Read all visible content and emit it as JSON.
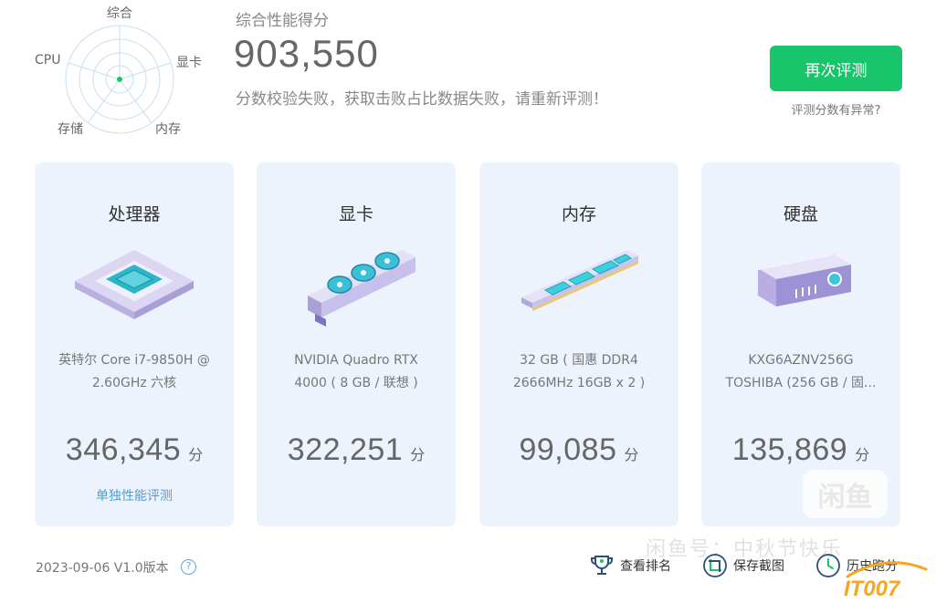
{
  "radar": {
    "labels": {
      "top": "综合",
      "left": "CPU",
      "right": "显卡",
      "bottom_left": "存储",
      "bottom_right": "内存"
    }
  },
  "header": {
    "title": "综合性能得分",
    "score": "903,550",
    "message": "分数校验失败，获取击败占比数据失败，请重新评测！",
    "retest_button": "再次评测",
    "anomaly_link": "评测分数有异常?"
  },
  "cards": [
    {
      "title": "处理器",
      "desc_line1": "英特尔 Core i7-9850H @",
      "desc_line2": "2.60GHz 六核",
      "score": "346,345",
      "unit": "分",
      "link": "单独性能评测"
    },
    {
      "title": "显卡",
      "desc_line1": "NVIDIA Quadro RTX",
      "desc_line2": "4000 ( 8 GB / 联想 )",
      "score": "322,251",
      "unit": "分"
    },
    {
      "title": "内存",
      "desc_line1": "32 GB ( 国惠 DDR4",
      "desc_line2": "2666MHz 16GB x 2 )",
      "score": "99,085",
      "unit": "分"
    },
    {
      "title": "硬盘",
      "desc_line1": "KXG6AZNV256G",
      "desc_line2": "TOSHIBA (256 GB / 固...",
      "score": "135,869",
      "unit": "分"
    }
  ],
  "footer": {
    "version": "2023-09-06 V1.0版本",
    "help": "?",
    "rank": "查看排名",
    "screenshot": "保存截图",
    "history": "历史跑分"
  },
  "watermark": {
    "box": "闲鱼",
    "text": "闲鱼号：中秋节快乐",
    "logo": "IT007"
  },
  "colors": {
    "accent_green": "#19c56b",
    "card_bg": "#ecf3fc",
    "link_blue": "#4a9fd8"
  }
}
